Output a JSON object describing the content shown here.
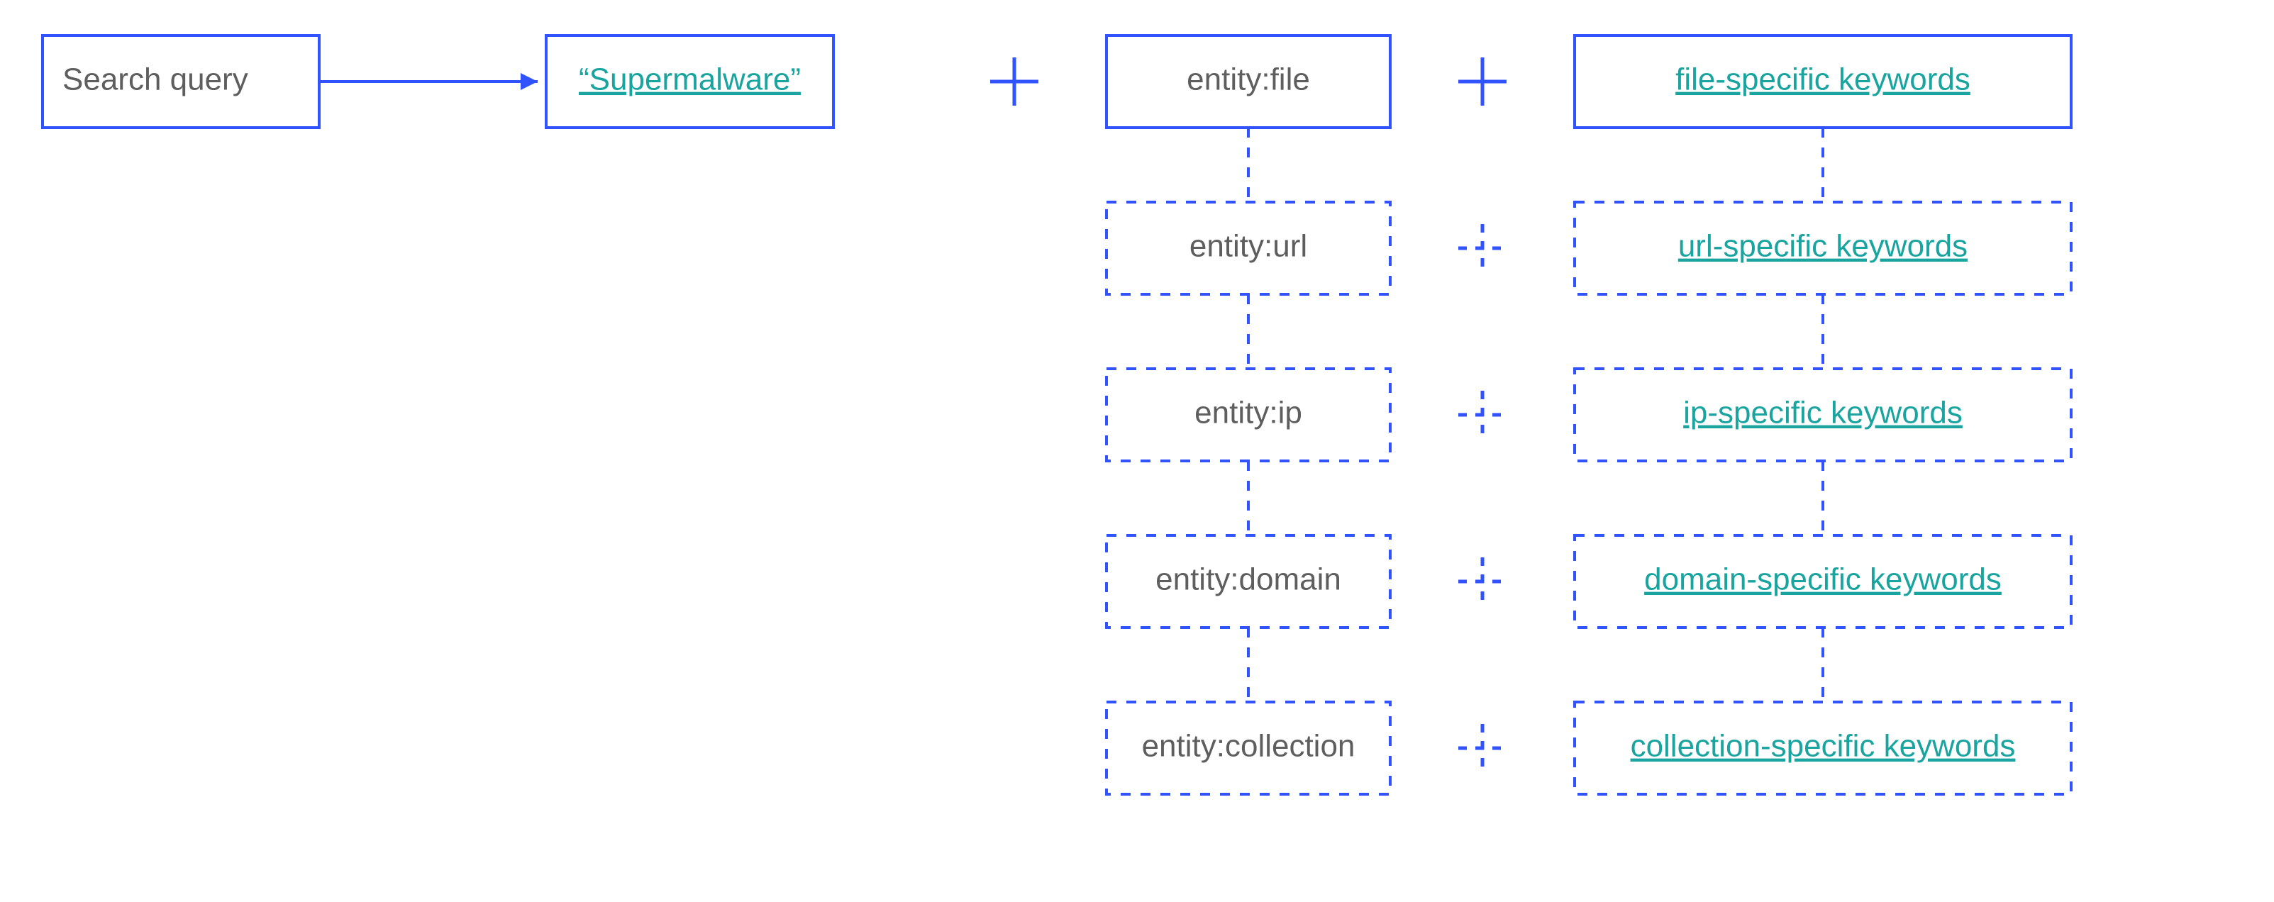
{
  "search_query_label": "Search query",
  "supermalware_label": "“Supermalware”",
  "rows": [
    {
      "entity": "entity:file",
      "keywords": "file-specific keywords",
      "solid": true
    },
    {
      "entity": "entity:url",
      "keywords": "url-specific keywords",
      "solid": false
    },
    {
      "entity": "entity:ip",
      "keywords": "ip-specific keywords",
      "solid": false
    },
    {
      "entity": "entity:domain",
      "keywords": "domain-specific keywords",
      "solid": false
    },
    {
      "entity": "entity:collection",
      "keywords": "collection-specific keywords",
      "solid": false
    }
  ],
  "colors": {
    "blue": "#3052ff",
    "teal": "#1aa4a0",
    "gray": "#5e5e5e"
  }
}
